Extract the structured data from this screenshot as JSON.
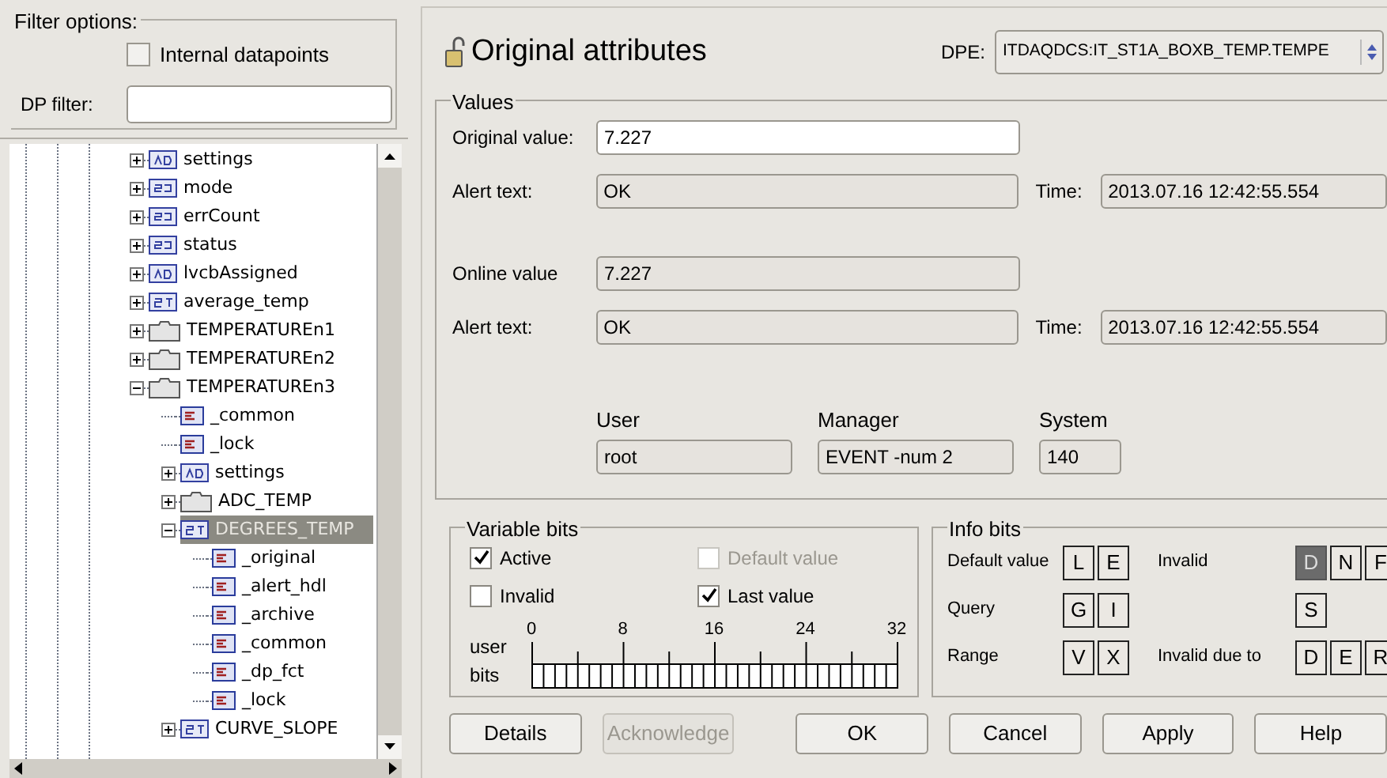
{
  "filter": {
    "title": "Filter options:",
    "internal": {
      "label": "Internal datapoints",
      "checked": false
    },
    "dp_filter": {
      "label": "DP filter:"
    }
  },
  "tree": {
    "items": [
      {
        "label": "settings",
        "kind": "ad",
        "expanded": false,
        "selected": false
      },
      {
        "label": "mode",
        "kind": "int",
        "expanded": false,
        "selected": false
      },
      {
        "label": "errCount",
        "kind": "int",
        "expanded": false,
        "selected": false
      },
      {
        "label": "status",
        "kind": "int",
        "expanded": false,
        "selected": false
      },
      {
        "label": "lvcbAssigned",
        "kind": "ad",
        "expanded": false,
        "selected": false
      },
      {
        "label": "average_temp",
        "kind": "float",
        "expanded": false,
        "selected": false
      },
      {
        "label": "TEMPERATUREn1",
        "kind": "folder",
        "expanded": false,
        "selected": false
      },
      {
        "label": "TEMPERATUREn2",
        "kind": "folder",
        "expanded": false,
        "selected": false
      },
      {
        "label": "TEMPERATUREn3",
        "kind": "folder",
        "expanded": true,
        "selected": false,
        "children": [
          {
            "label": "_common",
            "kind": "config",
            "selected": false
          },
          {
            "label": "_lock",
            "kind": "config",
            "selected": false
          },
          {
            "label": "settings",
            "kind": "ad",
            "expanded": false,
            "selected": false
          },
          {
            "label": "ADC_TEMP",
            "kind": "folder",
            "expanded": false,
            "selected": false
          },
          {
            "label": "DEGREES_TEMP",
            "kind": "float",
            "expanded": true,
            "selected": true,
            "children": [
              {
                "label": "_original",
                "kind": "config",
                "selected": false
              },
              {
                "label": "_alert_hdl",
                "kind": "config",
                "selected": false
              },
              {
                "label": "_archive",
                "kind": "config",
                "selected": false
              },
              {
                "label": "_common",
                "kind": "config",
                "selected": false
              },
              {
                "label": "_dp_fct",
                "kind": "config",
                "selected": false
              },
              {
                "label": "_lock",
                "kind": "config",
                "selected": false
              }
            ]
          },
          {
            "label": "CURVE_SLOPE",
            "kind": "float",
            "expanded": false,
            "selected": false
          }
        ]
      }
    ]
  },
  "title": "Original attributes",
  "dpe": {
    "label": "DPE:",
    "value": "ITDAQDCS:IT_ST1A_BOXB_TEMP.TEMPE"
  },
  "values": {
    "title": "Values",
    "original": {
      "label": "Original value:",
      "value": "7.227"
    },
    "original_alert": {
      "label": "Alert text:",
      "value": "OK",
      "time_label": "Time:",
      "time": "2013.07.16 12:42:55.554"
    },
    "online": {
      "label": "Online value",
      "value": "7.227"
    },
    "online_alert": {
      "label": "Alert text:",
      "value": "OK",
      "time_label": "Time:",
      "time": "2013.07.16 12:42:55.554"
    },
    "source": [
      {
        "label": "User",
        "value": "root"
      },
      {
        "label": "Manager",
        "value": "EVENT -num 2"
      },
      {
        "label": "System",
        "value": "140"
      }
    ]
  },
  "variable_bits": {
    "title": "Variable bits",
    "checks": [
      {
        "label": "Active",
        "checked": true,
        "disabled": false
      },
      {
        "label": "Default value",
        "checked": false,
        "disabled": true
      },
      {
        "label": "Invalid",
        "checked": false,
        "disabled": false
      },
      {
        "label": "Last value",
        "checked": true,
        "disabled": false
      }
    ],
    "user_bits_label": "user bits",
    "ticks": [
      "0",
      "8",
      "16",
      "24",
      "32"
    ]
  },
  "info_bits": {
    "title": "Info bits",
    "rows": [
      {
        "label": "Default value",
        "bits": [
          {
            "letter": "L",
            "on": false
          },
          {
            "letter": "E",
            "on": false
          }
        ],
        "label2": "Invalid",
        "bits2": [
          {
            "letter": "D",
            "on": true
          },
          {
            "letter": "N",
            "on": false
          },
          {
            "letter": "F",
            "on": false
          }
        ]
      },
      {
        "label": "Query",
        "bits": [
          {
            "letter": "G",
            "on": false
          },
          {
            "letter": "I",
            "on": false
          }
        ],
        "bits2": [
          {
            "letter": "S",
            "on": false
          }
        ]
      },
      {
        "label": "Range",
        "bits": [
          {
            "letter": "V",
            "on": false
          },
          {
            "letter": "X",
            "on": false
          }
        ],
        "label2": "Invalid due to",
        "bits2": [
          {
            "letter": "D",
            "on": false
          },
          {
            "letter": "E",
            "on": false
          },
          {
            "letter": "R",
            "on": false
          }
        ]
      }
    ]
  },
  "buttons": [
    {
      "label": "Details",
      "disabled": false
    },
    {
      "label": "Acknowledge",
      "disabled": true
    },
    {
      "label": "OK",
      "disabled": false
    },
    {
      "label": "Cancel",
      "disabled": false
    },
    {
      "label": "Apply",
      "disabled": false
    },
    {
      "label": "Help",
      "disabled": false
    }
  ]
}
